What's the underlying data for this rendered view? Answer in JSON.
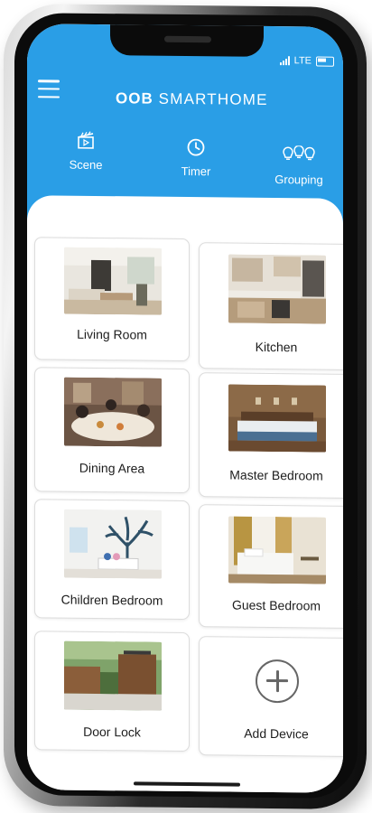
{
  "status": {
    "network": "LTE"
  },
  "header": {
    "brand_prefix": "OOB",
    "brand_suffix": "SMARTHOME",
    "tabs": [
      {
        "label": "Scene",
        "icon": "clapperboard-icon"
      },
      {
        "label": "Timer",
        "icon": "clock-icon"
      },
      {
        "label": "Grouping",
        "icon": "bulbs-icon"
      }
    ],
    "color": "#2a9ee6"
  },
  "rooms": [
    {
      "label": "Living Room"
    },
    {
      "label": "Kitchen"
    },
    {
      "label": "Dining Area"
    },
    {
      "label": "Master Bedroom"
    },
    {
      "label": "Children Bedroom"
    },
    {
      "label": "Guest Bedroom"
    },
    {
      "label": "Door Lock"
    }
  ],
  "add_device": {
    "label": "Add Device",
    "icon": "plus-circle-icon"
  }
}
